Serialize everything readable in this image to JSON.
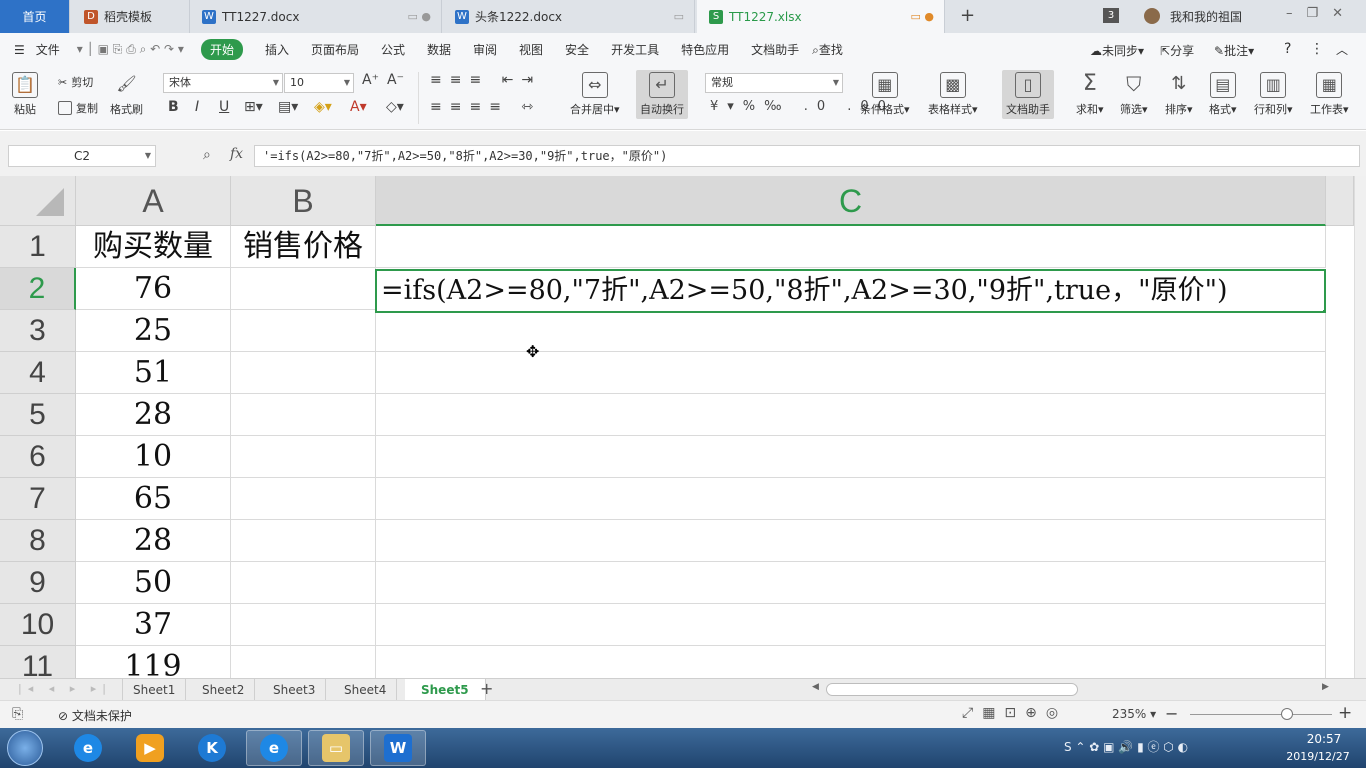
{
  "tabs": [
    {
      "label": "首页"
    },
    {
      "label": "稻壳模板"
    },
    {
      "label": "TT1227.docx"
    },
    {
      "label": "头条1222.docx"
    },
    {
      "label": "TT1227.xlsx"
    }
  ],
  "topright": {
    "badge": "3",
    "user": "我和我的祖国"
  },
  "menu": {
    "file": "文件",
    "items": [
      "开始",
      "插入",
      "页面布局",
      "公式",
      "数据",
      "审阅",
      "视图",
      "安全",
      "开发工具",
      "特色应用",
      "文档助手"
    ],
    "search": "查找",
    "sync": "未同步",
    "share": "分享",
    "comment": "批注",
    "help": "?"
  },
  "ribbon": {
    "paste": "粘贴",
    "cut": "剪切",
    "copy": "复制",
    "format_painter": "格式刷",
    "font_name": "宋体",
    "font_size": "10",
    "merge": "合并居中",
    "wrap": "自动换行",
    "number_format": "常规",
    "cond_format": "条件格式",
    "table_style": "表格样式",
    "doc_assistant": "文档助手",
    "sum": "求和",
    "filter": "筛选",
    "sort": "排序",
    "format": "格式",
    "rowcol": "行和列",
    "sheet": "工作表"
  },
  "formula_bar": {
    "cell_ref": "C2",
    "fx": "fx",
    "content": "'=ifs(A2>=80,\"7折\",A2>=50,\"8折\",A2>=30,\"9折\",true，\"原价\")"
  },
  "grid": {
    "columns": [
      "A",
      "B",
      "C"
    ],
    "rows": [
      "1",
      "2",
      "3",
      "4",
      "5",
      "6",
      "7",
      "8",
      "9",
      "10",
      "11"
    ],
    "headers": {
      "a1": "购买数量",
      "b1": "销售价格"
    },
    "col_a_values": [
      "76",
      "25",
      "51",
      "28",
      "10",
      "65",
      "28",
      "50",
      "37",
      "119"
    ],
    "c2": "=ifs(A2>=80,\"7折\",A2>=50,\"8折\",A2>=30,\"9折\",true，\"原价\")"
  },
  "sheets": [
    "Sheet1",
    "Sheet2",
    "Sheet3",
    "Sheet4",
    "Sheet5"
  ],
  "active_sheet": "Sheet5",
  "status": {
    "protect": "文档未保护",
    "zoom": "235%"
  },
  "clock": {
    "time": "20:57",
    "date": "2019/12/27"
  },
  "colors": {
    "accent": "#2e9a4c",
    "tab_blue": "#2e72c7"
  }
}
